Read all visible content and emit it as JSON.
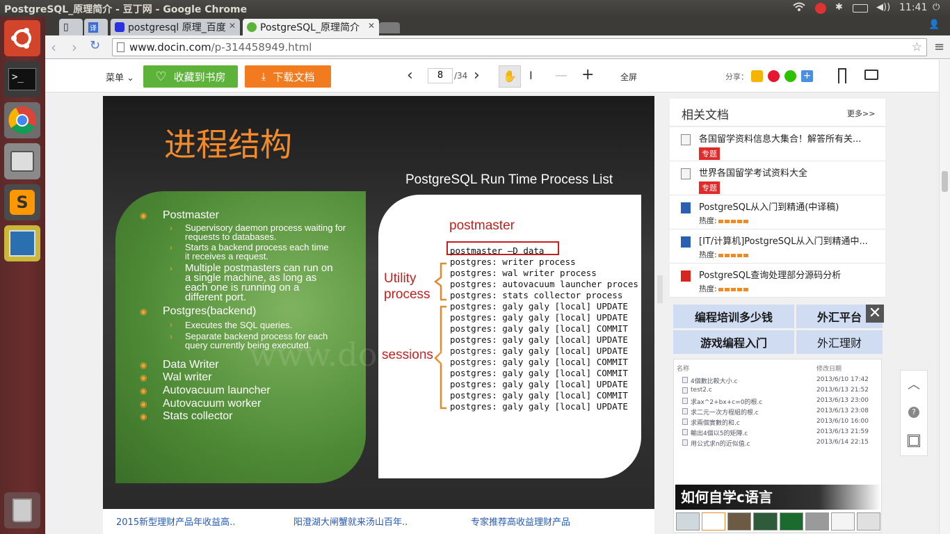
{
  "os_bar": {
    "window_title": "PostgreSQL_原理简介 - 豆丁网 - Google Chrome",
    "clock": "11:41"
  },
  "tabs": [
    {
      "label": ""
    },
    {
      "label": ""
    },
    {
      "label": "postgresql 原理_百度"
    },
    {
      "label": "PostgreSQL_原理简介"
    }
  ],
  "address": {
    "url_host": "www.docin.com",
    "url_path": "/p-314458949.html"
  },
  "docbar": {
    "menu": "菜单",
    "collect": "收藏到书房",
    "download": "下载文档",
    "page_current": "8",
    "page_total": "/34",
    "fullscreen": "全屏",
    "share": "分享："
  },
  "slide": {
    "title": "进程结构",
    "subtitle": "PostgreSQL Run Time Process List",
    "bullets": [
      {
        "text": "Postmaster",
        "level": 1
      },
      {
        "text": "Supervisory daemon process waiting for requests to databases.",
        "level": 2
      },
      {
        "text": "Starts a backend process each time it receives a request.",
        "level": 2
      },
      {
        "text": "Multiple postmasters can run on a single machine, as long as each one is running on a different port.",
        "level": 2
      },
      {
        "text": "Postgres(backend)",
        "level": 1
      },
      {
        "text": "Executes the SQL queries.",
        "level": 2
      },
      {
        "text": "Separate backend process for each query currently being executed.",
        "level": 2
      },
      {
        "text": "Data Writer",
        "level": 1
      },
      {
        "text": "Wal writer",
        "level": 1
      },
      {
        "text": "Autovacuum launcher",
        "level": 1
      },
      {
        "text": "Autovacuum worker",
        "level": 1
      },
      {
        "text": "Stats collector",
        "level": 1
      }
    ],
    "label_postmaster": "postmaster",
    "label_utility": "Utility",
    "label_process": "process",
    "label_sessions": "sessions",
    "watermark": "www.docin.com",
    "process_lines": [
      "postmaster –D data",
      "postgres: writer process",
      "postgres: wal writer process",
      "postgres: autovacuum launcher proces",
      "postgres: stats collector process",
      "postgres: galy galy [local] UPDATE",
      "postgres: galy galy [local] UPDATE",
      "postgres: galy galy [local] COMMIT",
      "postgres: galy galy [local] UPDATE",
      "postgres: galy galy [local] UPDATE",
      "postgres: galy galy [local] COMMIT",
      "postgres: galy galy [local] COMMIT",
      "postgres: galy galy [local] UPDATE",
      "postgres: galy galy [local] COMMIT",
      "postgres: galy galy [local] UPDATE"
    ]
  },
  "sidebar": {
    "title": "相关文档",
    "more": "更多>>",
    "docs": [
      {
        "title": "各国留学资料信息大集合！解答所有关...",
        "tag": "专题"
      },
      {
        "title": "世界各国留学考试资料大全",
        "tag": "专题"
      },
      {
        "title": "PostgreSQL从入门到精通(中译稿)",
        "heat": "热度:"
      },
      {
        "title": "[IT/计算机]PostgreSQL从入门到精通中...",
        "heat": "热度:"
      },
      {
        "title": "PostgreSQL查询处理部分源码分析",
        "heat": "热度:"
      }
    ],
    "ads": [
      "编程培训多少钱",
      "外汇平台",
      "游戏编程入门",
      "外汇理财"
    ],
    "file_panel": {
      "col_name": "名称",
      "col_date": "修改日期",
      "rows": [
        {
          "name": "4個數比較大小.c",
          "date": "2013/6/10 17:42"
        },
        {
          "name": "test2.c",
          "date": "2013/6/13 21:52"
        },
        {
          "name": "求ax^2+bx+c=0的根.c",
          "date": "2013/6/13 23:00"
        },
        {
          "name": "求二元一次方程組的根.c",
          "date": "2013/6/13 23:08"
        },
        {
          "name": "求兩個實數的和.c",
          "date": "2013/6/10 16:00"
        },
        {
          "name": "輸出4個以5的矩陣.c",
          "date": "2013/6/13 21:59"
        },
        {
          "name": "用公式求n的近似值.c",
          "date": "2013/6/14 22:15"
        }
      ],
      "caption": "如何自学c语言"
    }
  },
  "bottom_links": [
    "2015新型理财产品年收益高..",
    "阳澄湖大闸蟹就来汤山百年..",
    "专家推荐高收益理财产品"
  ],
  "colors": {
    "green": "#5db33a",
    "orange": "#f27a1f",
    "accent_red": "#d0321f"
  }
}
